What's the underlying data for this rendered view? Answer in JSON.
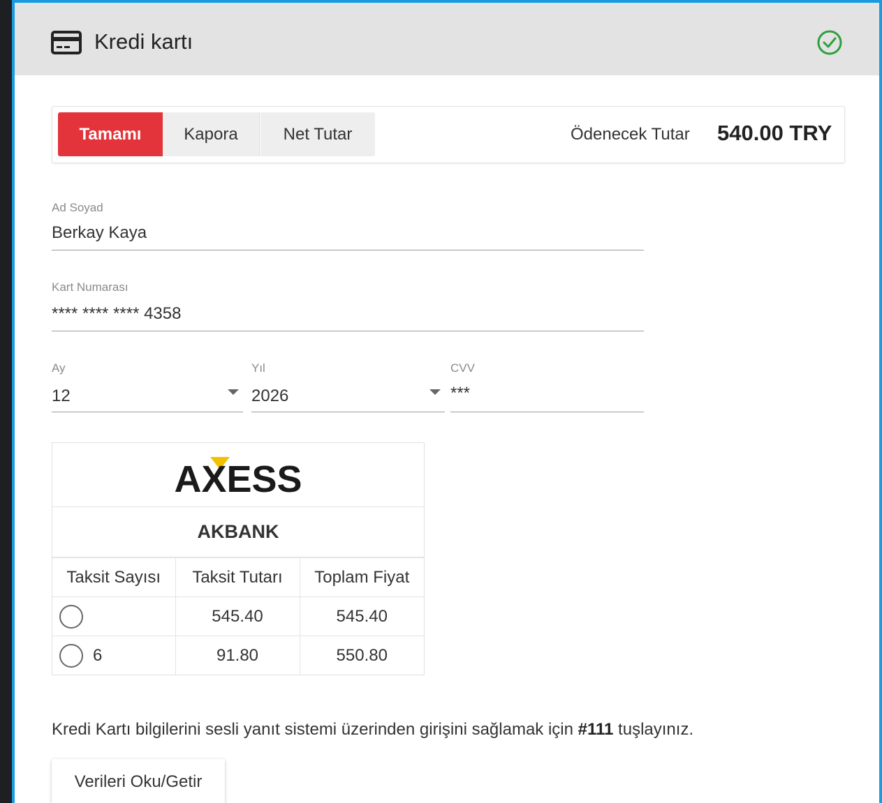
{
  "header": {
    "title": "Kredi kartı",
    "card_icon": "credit-card-icon",
    "status_icon": "check-circle-icon"
  },
  "payment": {
    "segments": [
      "Tamamı",
      "Kapora",
      "Net Tutar"
    ],
    "selected_segment": "Tamamı",
    "amount_label": "Ödenecek Tutar",
    "amount_value": "540.00 TRY"
  },
  "form": {
    "name_label": "Ad Soyad",
    "name_value": "Berkay Kaya",
    "card_label": "Kart Numarası",
    "card_value": "**** **** **** 4358",
    "month_label": "Ay",
    "month_value": "12",
    "year_label": "Yıl",
    "year_value": "2026",
    "cvv_label": "CVV",
    "cvv_value": "***"
  },
  "bank": {
    "logo_text": "AXESS",
    "name": "AKBANK",
    "columns": [
      "Taksit Sayısı",
      "Taksit Tutarı",
      "Toplam Fiyat"
    ],
    "rows": [
      {
        "count": "",
        "installment": "545.40",
        "total": "545.40"
      },
      {
        "count": "6",
        "installment": "91.80",
        "total": "550.80"
      }
    ]
  },
  "ivr": {
    "before": "Kredi Kartı bilgilerini sesli yanıt sistemi üzerinden girişini sağlamak için ",
    "code": "#111",
    "after": " tuşlayınız."
  },
  "actions": {
    "read_button": "Verileri Oku/Getir"
  },
  "colors": {
    "accent_red": "#e3343b",
    "frame_blue": "#1a9be0",
    "success_green": "#2e9e3e",
    "axess_yellow": "#f2c200"
  }
}
